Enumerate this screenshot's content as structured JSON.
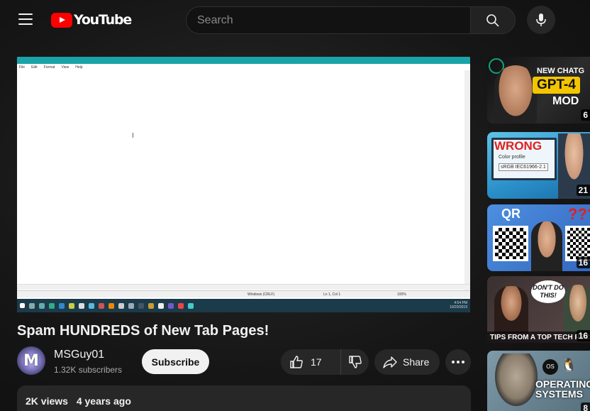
{
  "header": {
    "logo_text": "YouTube",
    "search_placeholder": "Search"
  },
  "player": {
    "notepad_menu": [
      "File",
      "Edit",
      "Format",
      "View",
      "Help"
    ],
    "status_encoding": "Windows (CRLF)",
    "status_position": "Ln 1, Col 1",
    "status_zoom": "100%",
    "tray_time": "4:54 PM",
    "tray_date": "10/20/2019"
  },
  "video": {
    "title": "Spam HUNDREDS of New Tab Pages!",
    "channel_name": "MSGuy01",
    "subscribers": "1.32K subscribers",
    "subscribe_label": "Subscribe",
    "likes": "17",
    "share_label": "Share",
    "views": "2K views",
    "age": "4 years ago"
  },
  "sidebar": {
    "items": [
      {
        "line1": "NEW CHATG",
        "line2": "GPT-4",
        "line3": "MOD",
        "duration": "6"
      },
      {
        "line1": "WRONG",
        "line2": "Color profile",
        "line3": "sRGB IEC61966-2.1",
        "duration": "21"
      },
      {
        "line1": "QR",
        "line2": "???",
        "duration": "16"
      },
      {
        "line1": "DON'T DO THIS!",
        "line2": "TIPS FROM A TOP TECH RECRUI",
        "duration": "16"
      },
      {
        "line1": "OS",
        "line2": "OPERATING SYSTEMS",
        "duration": "8"
      }
    ]
  },
  "colors": {
    "brand_red": "#ff0000",
    "background": "#0f0f0f",
    "button_bg": "#272727"
  }
}
